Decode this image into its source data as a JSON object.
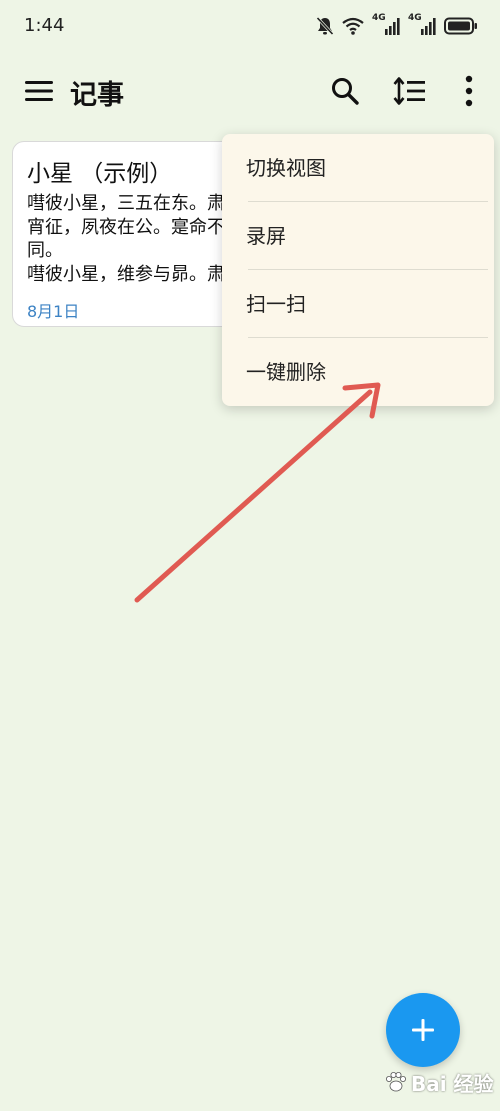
{
  "status_bar": {
    "time": "1:44",
    "signal1_label": "4G",
    "signal2_label": "4G"
  },
  "app_bar": {
    "title": "记事",
    "icons": [
      "menu-icon",
      "search-icon",
      "sort-icon",
      "more-vert-icon"
    ]
  },
  "note": {
    "title": "小星 （示例）",
    "body": "嘒彼小星，三五在东。肃肃\n宵征，夙夜在公。寔命不\n同。\n嘒彼小星，维参与昴。肃肃",
    "date": "8月1日"
  },
  "menu": {
    "items": [
      {
        "label": "切换视图"
      },
      {
        "label": "录屏"
      },
      {
        "label": "扫一扫"
      },
      {
        "label": "一键删除"
      }
    ]
  },
  "fab": {
    "icon": "plus-icon"
  },
  "watermark": {
    "text": "Bai 经验"
  },
  "colors": {
    "background": "#eef5e6",
    "menu_background": "#fcf7ea",
    "accent": "#1a98f0",
    "date": "#3d83c4",
    "annotation_arrow": "#e05a52"
  }
}
